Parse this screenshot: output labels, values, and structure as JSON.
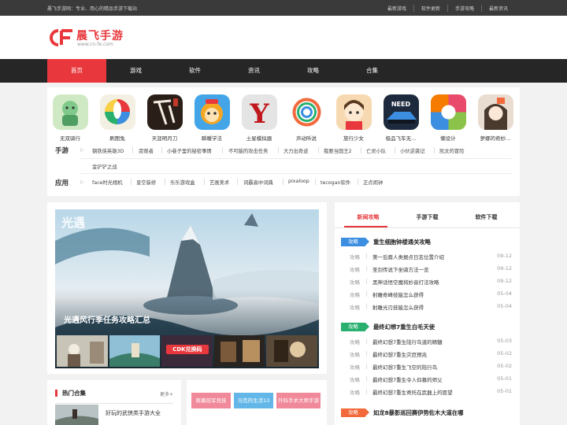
{
  "topbar": {
    "slogan": "晨飞手游网：专业、用心的精品手游下载站",
    "links": [
      "最新游戏",
      "软件更新",
      "手游攻略",
      "最新资讯"
    ]
  },
  "logo": {
    "cn": "晨飞手游",
    "en": "www.cn-fe.com",
    "mark": "CF"
  },
  "nav": [
    "首页",
    "游戏",
    "软件",
    "资讯",
    "攻略",
    "合集"
  ],
  "apps": [
    {
      "name": "无双骑行",
      "color": "#7fc98a"
    },
    {
      "name": "刷图兔",
      "color": "#e9e2d1"
    },
    {
      "name": "天涯明月刀",
      "color": "#3b2a22"
    },
    {
      "name": "瞬暖学法",
      "color": "#43a5e8"
    },
    {
      "name": "土星模拟器",
      "color": "#e4e4e4"
    },
    {
      "name": "声动听说",
      "color": "#ffffff"
    },
    {
      "name": "旅行少女",
      "color": "#f0c89a"
    },
    {
      "name": "极品飞车无...",
      "color": "#1d2a3d"
    },
    {
      "name": "懒设计",
      "color": "#e94a6b"
    },
    {
      "name": "萝娜的奇妙...",
      "color": "#d9c7b3"
    }
  ],
  "games_row": {
    "label": "手游",
    "tags": [
      "钢铁侠英雄3D",
      "旁观者",
      "小巷子里的秘密事情",
      "不可能的攻击任务",
      "大力出奇迹",
      "我要当国王2",
      "亡灵小队",
      "小伙逆袭记",
      "凯文的冒险",
      "金铲铲之战"
    ]
  },
  "apps_row": {
    "label": "应用",
    "tags": [
      "face时光相机",
      "皇空装修",
      "乐乐游戏盒",
      "艺画美术",
      "词霸高中词典",
      "pixaloop",
      "tecogan软件",
      "正点闹钟"
    ]
  },
  "slide": {
    "title": "光遇风行季任务攻略汇总",
    "badge": "光遇",
    "thumb_labels": [
      "",
      "",
      "CDK兑换码",
      "",
      ""
    ]
  },
  "news": {
    "tabs": [
      "新闻攻略",
      "手游下载",
      "软件下载"
    ],
    "groups": [
      {
        "badge": "攻略",
        "badge_color": "blue",
        "headline": "重生细胞钟楼通关攻略",
        "items": [
          {
            "cat": "攻略",
            "title": "第一后裔人类据点日志位置介绍",
            "date": "09-12"
          },
          {
            "cat": "攻略",
            "title": "圣剑传说下坐骑方法一览",
            "date": "09-12"
          },
          {
            "cat": "攻略",
            "title": "黑神话悟空魔将妙音打法攻略",
            "date": "09-12"
          },
          {
            "cat": "攻略",
            "title": "射雕奇峰技能怎么获得",
            "date": "05-04"
          },
          {
            "cat": "攻略",
            "title": "射雕光刃技能怎么获得",
            "date": "05-04"
          }
        ]
      },
      {
        "badge": "攻略",
        "badge_color": "green",
        "headline": "最终幻想7重生白毛天使",
        "items": [
          {
            "cat": "攻略",
            "title": "最终幻想7重生陆行鸟道的精髓",
            "date": "05-03"
          },
          {
            "cat": "攻略",
            "title": "最终幻想7重生灾厄预兆",
            "date": "05-02"
          },
          {
            "cat": "攻略",
            "title": "最终幻想7重生飞空的陆行鸟",
            "date": "05-02"
          },
          {
            "cat": "攻略",
            "title": "最终幻想7重生令人仰慕的师父",
            "date": "05-01"
          },
          {
            "cat": "攻略",
            "title": "最终幻想7重生寄托在武器上的愿望",
            "date": "05-01"
          }
        ]
      },
      {
        "badge": "攻略",
        "badge_color": "orange",
        "headline": "如龙8暴影巡回赛伊势佐木大道在哪",
        "items": []
      }
    ]
  },
  "hot": {
    "title": "热门合集",
    "more": "更多+",
    "item": "好玩的武侠类手游大全"
  },
  "collections": [
    {
      "label": "原幕冠军竞技",
      "color": "#f08a9b"
    },
    {
      "label": "马克的生活13",
      "color": "#63b7e8"
    },
    {
      "label": "外科手术大师手游",
      "color": "#f08a9b"
    }
  ]
}
